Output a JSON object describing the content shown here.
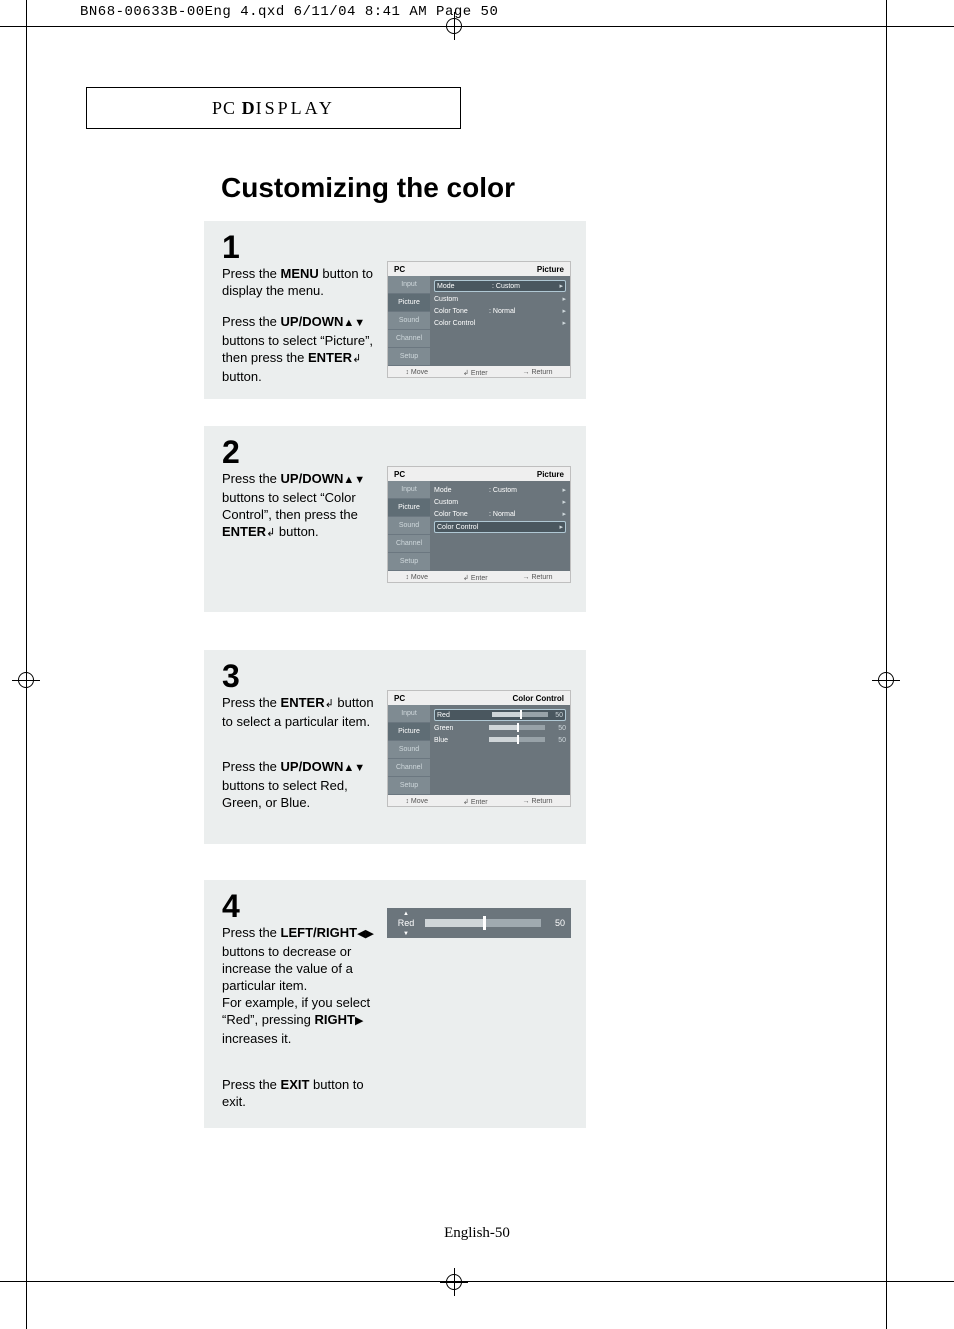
{
  "slug": "BN68-00633B-00Eng 4.qxd  6/11/04 8:41 AM  Page 50",
  "header_label_prefix": "PC ",
  "header_label_main": "D",
  "header_label_rest": "ISPLAY",
  "page_title": "Customizing the color",
  "page_number": "English-50",
  "steps": {
    "s1": {
      "num": "1",
      "p1_a": "Press the ",
      "p1_b": "MENU",
      "p1_c": " button to display the menu.",
      "p2_a": "Press the ",
      "p2_b": "UP/DOWN",
      "p2_c": " buttons to select “Picture”, then press the ",
      "p2_d": "ENTER",
      "p2_e": " button."
    },
    "s2": {
      "num": "2",
      "p1_a": "Press the ",
      "p1_b": "UP/DOWN",
      "p1_c": " buttons to select “Color Control”, then press the ",
      "p1_d": "ENTER",
      "p1_e": " button."
    },
    "s3": {
      "num": "3",
      "p1_a": "Press the ",
      "p1_b": "ENTER",
      "p1_c": " button to select a particular item.",
      "p2_a": "Press the ",
      "p2_b": "UP/DOWN",
      "p2_c": " buttons to select Red, Green, or Blue."
    },
    "s4": {
      "num": "4",
      "p1_a": "Press the ",
      "p1_b": "LEFT/RIGHT",
      "p1_c": " buttons to decrease or increase the value of a particular item.",
      "p1_d": "For example, if you select “Red”, pressing ",
      "p1_e": "RIGHT",
      "p1_f": " increases it.",
      "p2_a": "Press the ",
      "p2_b": "EXIT",
      "p2_c": " button to exit."
    }
  },
  "osd": {
    "source": "PC",
    "tabs": [
      "Input",
      "Picture",
      "Sound",
      "Channel",
      "Setup"
    ],
    "foot_move": "Move",
    "foot_enter": "Enter",
    "foot_return": "Return"
  },
  "osd1": {
    "title": "Picture",
    "rows": [
      {
        "lbl": "Mode",
        "val": ":   Custom",
        "hi": true
      },
      {
        "lbl": "Custom",
        "val": ""
      },
      {
        "lbl": "Color Tone",
        "val": ":   Normal"
      },
      {
        "lbl": "Color Control",
        "val": ""
      }
    ]
  },
  "osd2": {
    "title": "Picture",
    "rows": [
      {
        "lbl": "Mode",
        "val": ":   Custom"
      },
      {
        "lbl": "Custom",
        "val": ""
      },
      {
        "lbl": "Color Tone",
        "val": ":   Normal"
      },
      {
        "lbl": "Color Control",
        "val": "",
        "hi": true
      }
    ]
  },
  "osd3": {
    "title": "Color Control",
    "rows": [
      {
        "lbl": "Red",
        "slider": true,
        "num": "50",
        "hi": true
      },
      {
        "lbl": "Green",
        "slider": true,
        "num": "50"
      },
      {
        "lbl": "Blue",
        "slider": true,
        "num": "50"
      }
    ]
  },
  "adjust": {
    "label_top": "▲",
    "label": "Red",
    "label_bot": "▼",
    "value": "50"
  },
  "glyph": {
    "updown": "▲▼",
    "leftright": "◀▶",
    "right": "▶",
    "enter": "↲",
    "move": "↕",
    "ret": "→"
  }
}
